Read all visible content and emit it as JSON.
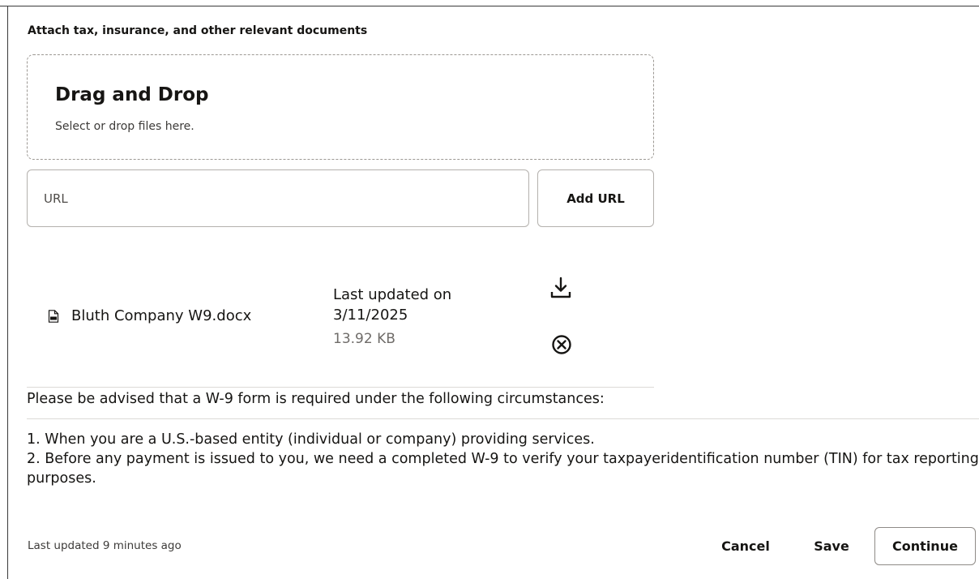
{
  "attachments": {
    "section_label": "Attach tax, insurance, and other relevant documents",
    "dropzone": {
      "title": "Drag and Drop",
      "subtitle": "Select or drop files here."
    },
    "url_field": {
      "placeholder": "URL",
      "value": ""
    },
    "add_url_label": "Add URL",
    "files": [
      {
        "name": "Bluth Company W9.docx",
        "updated": "Last updated on 3/11/2025",
        "size": "13.92 KB",
        "icon": "document-icon"
      }
    ]
  },
  "advice": {
    "intro": "Please be advised that a W-9 form is required under the following circumstances:",
    "items": [
      "1. When you are a U.S.-based entity (individual or company) providing services.",
      "2. Before any payment is issued to you, we need a completed W-9 to verify your taxpayeridentification number (TIN) for tax reporting purposes."
    ]
  },
  "footer": {
    "last_updated": "Last updated 9 minutes ago",
    "cancel_label": "Cancel",
    "save_label": "Save",
    "continue_label": "Continue"
  },
  "icons": {
    "download": "download-icon",
    "remove": "remove-circle-icon"
  },
  "colors": {
    "text": "#161513",
    "muted": "#6f6c69",
    "border": "#b4b1ad"
  }
}
